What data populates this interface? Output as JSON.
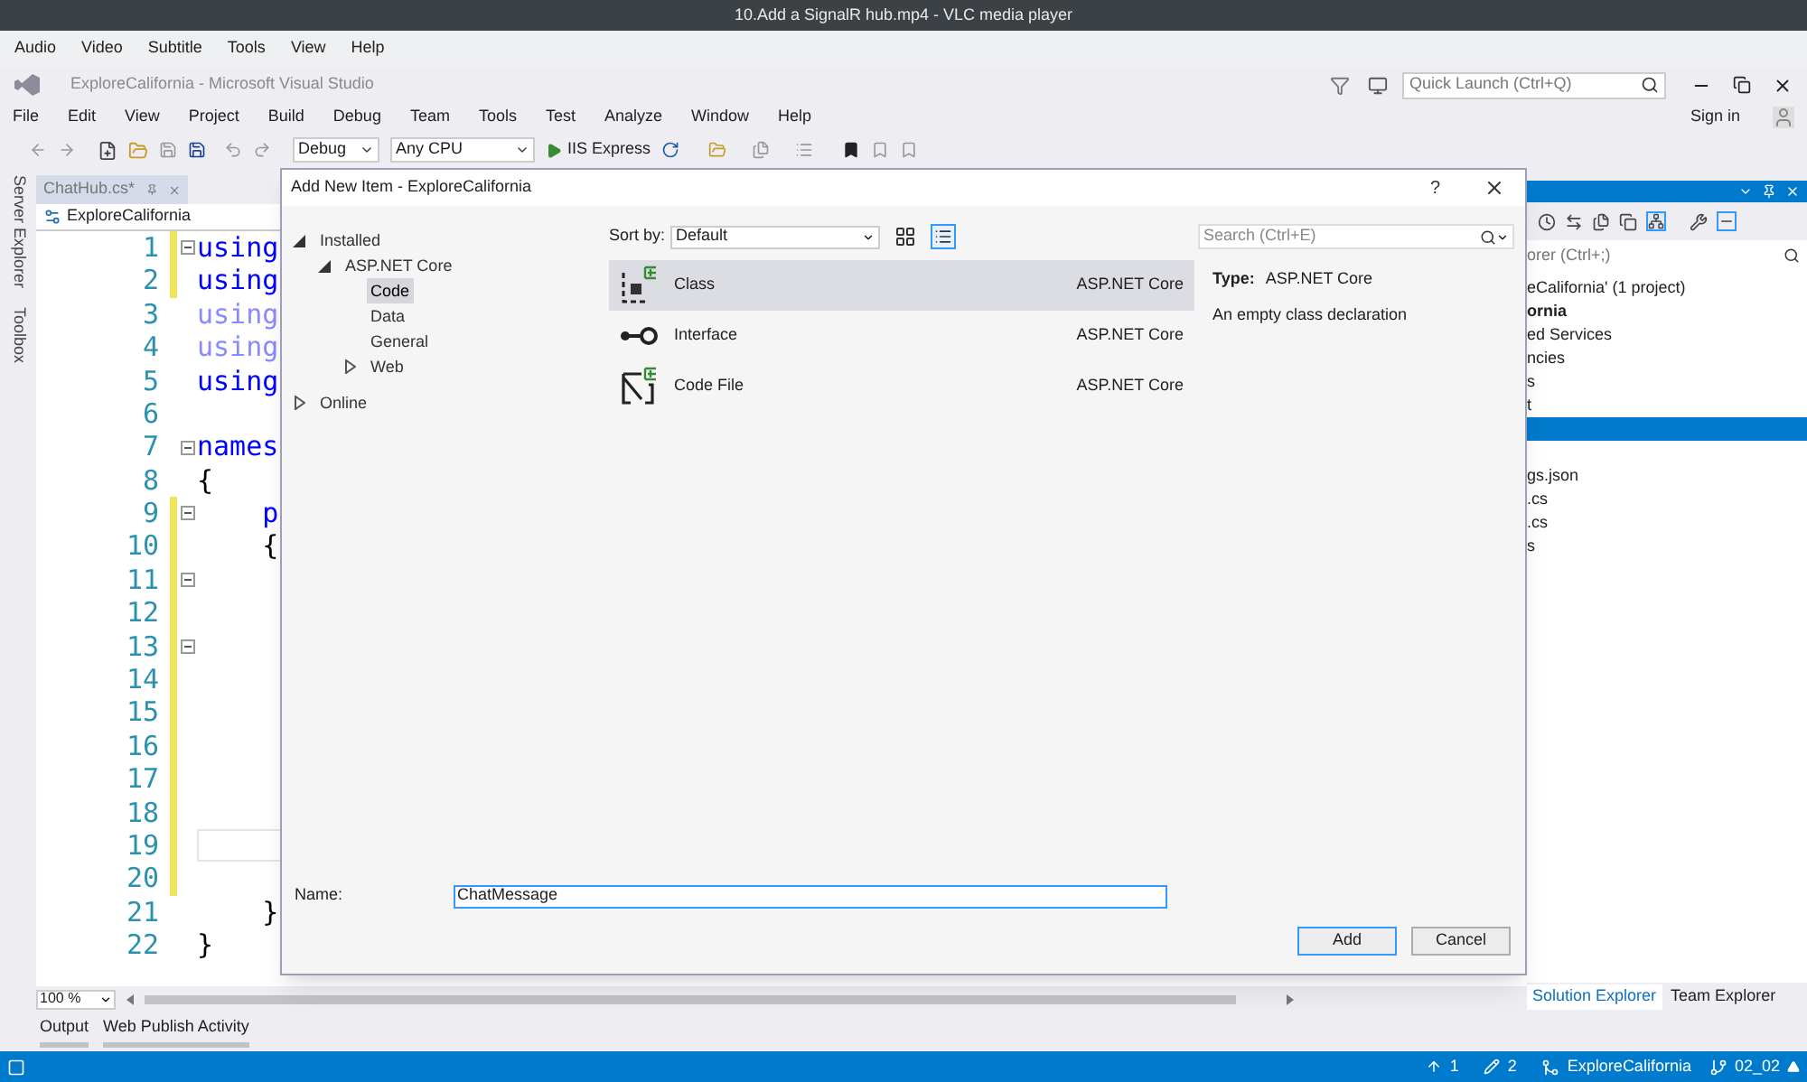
{
  "player": {
    "title": "10.Add a SignalR hub.mp4 - VLC media player",
    "menu": [
      "Audio",
      "Video",
      "Subtitle",
      "Tools",
      "View",
      "Help"
    ]
  },
  "ide": {
    "title": "ExploreCalifornia - Microsoft Visual Studio",
    "quick_launch": {
      "placeholder": "Quick Launch (Ctrl+Q)"
    },
    "menu": [
      "File",
      "Edit",
      "View",
      "Project",
      "Build",
      "Debug",
      "Team",
      "Tools",
      "Test",
      "Analyze",
      "Window",
      "Help"
    ],
    "sign_in": "Sign in",
    "toolbar": {
      "configuration": "Debug",
      "platform": "Any CPU",
      "run": "IIS Express"
    }
  },
  "side_tabs": [
    "Server Explorer",
    "Toolbox"
  ],
  "editor": {
    "tab": {
      "label": "ChatHub.cs*",
      "selected": false
    },
    "navigation": "ExploreCalifornia",
    "zoom": "100 %",
    "lines": [
      {
        "number": "1",
        "code": "using",
        "kind": "keyword",
        "fold": true,
        "changed": true,
        "current": false
      },
      {
        "number": "2",
        "code": "using",
        "kind": "keyword",
        "fold": false,
        "changed": true,
        "current": false
      },
      {
        "number": "3",
        "code": "using",
        "kind": "faded",
        "fold": false,
        "changed": false,
        "current": false
      },
      {
        "number": "4",
        "code": "using",
        "kind": "faded",
        "fold": false,
        "changed": false,
        "current": false
      },
      {
        "number": "5",
        "code": "using",
        "kind": "keyword",
        "fold": false,
        "changed": false,
        "current": false
      },
      {
        "number": "6",
        "fold": false,
        "changed": false,
        "current": false
      },
      {
        "number": "7",
        "code": "names",
        "kind": "keyword",
        "fold": true,
        "changed": false,
        "current": false
      },
      {
        "number": "8",
        "code": "{",
        "kind": "plain",
        "fold": false,
        "changed": false,
        "current": false
      },
      {
        "number": "9",
        "code": "    p",
        "kind": "keyword",
        "fold": true,
        "changed": true,
        "current": false
      },
      {
        "number": "10",
        "code": "    {",
        "kind": "plain",
        "fold": false,
        "changed": true,
        "current": false
      },
      {
        "number": "11",
        "fold": true,
        "changed": true,
        "current": false
      },
      {
        "number": "12",
        "fold": false,
        "changed": true,
        "current": false
      },
      {
        "number": "13",
        "fold": true,
        "changed": true,
        "current": false
      },
      {
        "number": "14",
        "fold": false,
        "changed": true,
        "current": false
      },
      {
        "number": "15",
        "fold": false,
        "changed": true,
        "current": false
      },
      {
        "number": "16",
        "fold": false,
        "changed": true,
        "current": false
      },
      {
        "number": "17",
        "fold": false,
        "changed": true,
        "current": false
      },
      {
        "number": "18",
        "fold": false,
        "changed": true,
        "current": false
      },
      {
        "number": "19",
        "fold": false,
        "changed": true,
        "current": true
      },
      {
        "number": "20",
        "fold": false,
        "changed": true,
        "current": false
      },
      {
        "number": "21",
        "code": "    }",
        "kind": "plain",
        "fold": false,
        "changed": false,
        "current": false
      },
      {
        "number": "22",
        "code": "}",
        "kind": "plain",
        "fold": false,
        "changed": false,
        "current": false
      }
    ]
  },
  "solution_explorer": {
    "search": {
      "placeholder": "orer (Ctrl+;)"
    },
    "items": [
      {
        "text": "eCalifornia' (1 project)",
        "bold": false,
        "selected": false
      },
      {
        "text": "ornia",
        "bold": true,
        "selected": false
      },
      {
        "text": "ed Services",
        "bold": false,
        "selected": false
      },
      {
        "text": "ncies",
        "bold": false,
        "selected": false
      },
      {
        "text": "s",
        "bold": false,
        "selected": false
      },
      {
        "text": "t",
        "bold": false,
        "selected": false
      },
      {
        "selected": true
      },
      {
        "selected": false
      },
      {
        "text": "gs.json",
        "bold": false,
        "selected": false
      },
      {
        "text": ".cs",
        "bold": false,
        "selected": false
      },
      {
        "text": ".cs",
        "bold": false,
        "selected": false
      },
      {
        "text": "s",
        "bold": false,
        "selected": false
      }
    ],
    "tabs": [
      {
        "label": "Solution Explorer",
        "selected": true
      },
      {
        "label": "Team Explorer",
        "selected": false
      }
    ]
  },
  "bottom_tabs": [
    "Output",
    "Web Publish Activity"
  ],
  "dialog": {
    "title": "Add New Item - ExploreCalifornia",
    "help": "?",
    "tree": [
      {
        "label": "Installed",
        "expanded": true,
        "selected": false,
        "children": [
          {
            "label": "ASP.NET Core",
            "expanded": true,
            "selected": false,
            "children": [
              {
                "label": "Code",
                "selected": true
              },
              {
                "label": "Data",
                "selected": false
              },
              {
                "label": "General",
                "selected": false
              },
              {
                "label": "Web",
                "expanded": false,
                "selected": false
              }
            ]
          }
        ]
      },
      {
        "label": "Online",
        "expanded": false,
        "selected": false
      }
    ],
    "sort": {
      "label": "Sort by:",
      "value": "Default"
    },
    "views": [
      {
        "kind": "grid",
        "selected": false
      },
      {
        "kind": "list",
        "selected": true
      }
    ],
    "search": {
      "placeholder": "Search (Ctrl+E)"
    },
    "templates": [
      {
        "name": "Class",
        "category": "ASP.NET Core",
        "kind": "class",
        "selected": true
      },
      {
        "name": "Interface",
        "category": "ASP.NET Core",
        "kind": "interface",
        "selected": false
      },
      {
        "name": "Code File",
        "category": "ASP.NET Core",
        "kind": "codefile",
        "selected": false
      }
    ],
    "details": {
      "type_label": "Type:",
      "type_value": "ASP.NET Core",
      "description": "An empty class declaration"
    },
    "name": {
      "label": "Name:",
      "value": "ChatMessage"
    },
    "buttons": [
      {
        "label": "Add",
        "kind": "primary"
      },
      {
        "label": "Cancel",
        "kind": "secondary"
      }
    ]
  },
  "status_bar": {
    "pushes": "1",
    "edits": "2",
    "repository": "ExploreCalifornia",
    "branch": "02_02"
  }
}
